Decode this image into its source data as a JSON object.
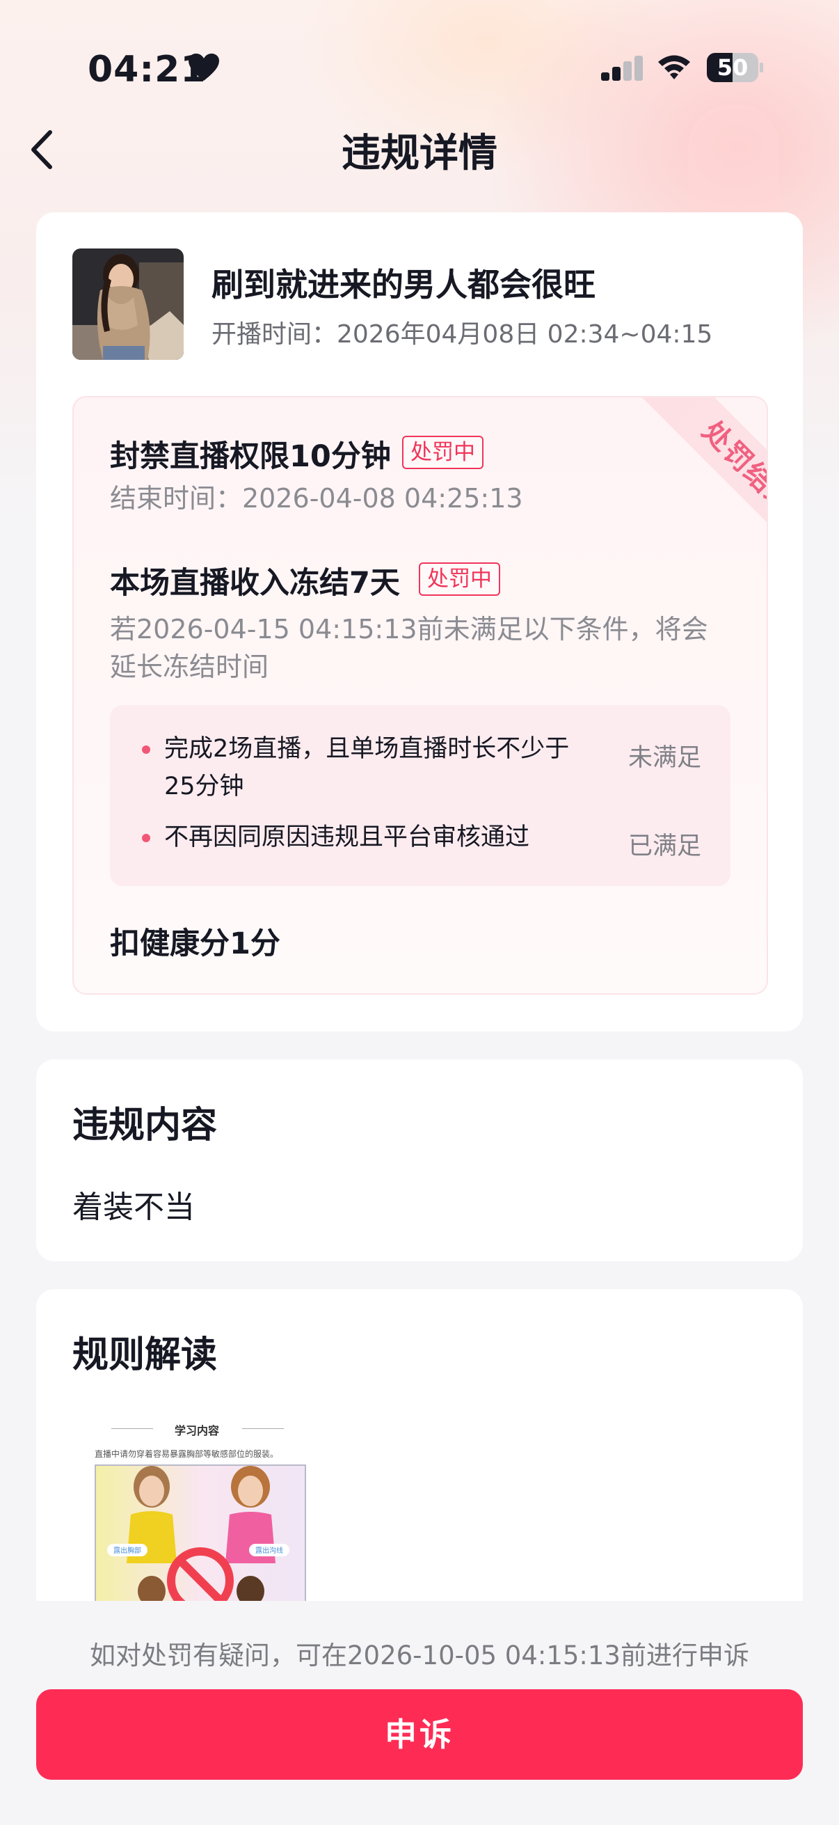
{
  "status_bar": {
    "time": "04:21",
    "battery": "50",
    "battery_level": 0.5
  },
  "header": {
    "title": "违规详情"
  },
  "live": {
    "title": "刷到就进来的男人都会很旺",
    "time": "开播时间：2026年04月08日 02:34~04:15"
  },
  "penalty": {
    "ribbon": "处罚结果",
    "items": [
      {
        "title": "封禁直播权限10分钟",
        "tag": "处罚中",
        "note": "结束时间：2026-04-08 04:25:13"
      },
      {
        "title": "本场直播收入冻结7天",
        "tag": "处罚中",
        "note": "若2026-04-15 04:15:13前未满足以下条件，将会延长冻结时间"
      }
    ],
    "conditions": [
      {
        "text": "完成2场直播，且单场直播时长不少于25分钟",
        "status": "未满足"
      },
      {
        "text": "不再因同原因违规且平台审核通过",
        "status": "已满足"
      }
    ],
    "health": "扣健康分1分"
  },
  "violation": {
    "title": "违规内容",
    "content": "着装不当"
  },
  "rules": {
    "title": "规则解读",
    "image": {
      "heading": "学习内容",
      "desc": "直播中请勿穿着容易暴露胸部等敏感部位的服装。",
      "label_left": "露出胸部",
      "label_right": "露出沟线"
    }
  },
  "footer": {
    "hint": "如对处罚有疑问，可在2026-10-05 04:15:13前进行申诉",
    "button": "申诉"
  },
  "colors": {
    "accent": "#fe2c55",
    "tag": "#f0355a",
    "ribbon": "#f06080"
  }
}
